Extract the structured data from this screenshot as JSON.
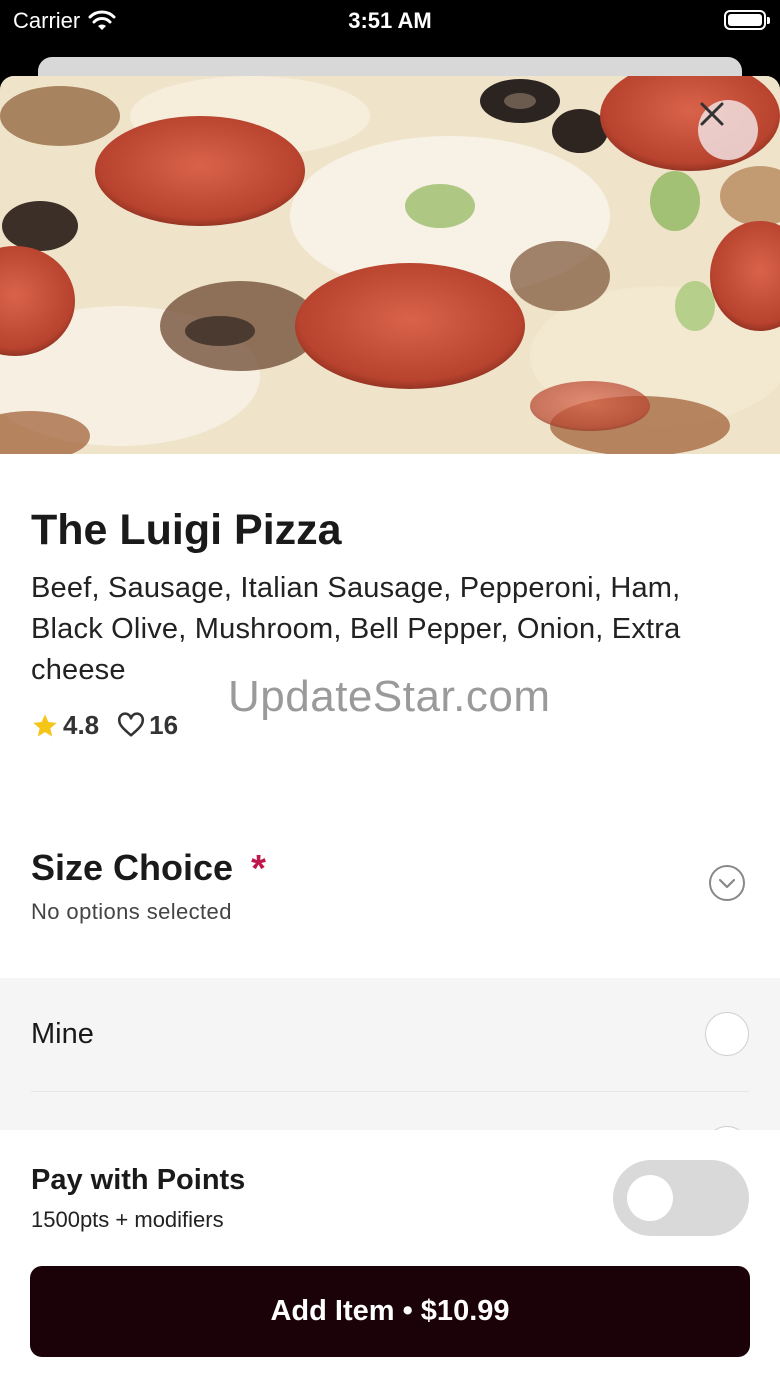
{
  "status_bar": {
    "carrier": "Carrier",
    "time": "3:51 AM"
  },
  "product": {
    "title": "The Luigi Pizza",
    "description": "Beef, Sausage, Italian Sausage, Pepperoni, Ham, Black Olive, Mushroom, Bell Pepper, Onion, Extra cheese",
    "rating": "4.8",
    "likes": "16"
  },
  "watermark": "UpdateStar.com",
  "size_choice": {
    "title": "Size Choice",
    "required_mark": "*",
    "subtitle": "No options selected",
    "options": [
      {
        "label": "Mine"
      }
    ]
  },
  "pay_with_points": {
    "title": "Pay with Points",
    "subtitle": "1500pts + modifiers",
    "enabled": false
  },
  "add_button": {
    "label": "Add Item • $10.99"
  },
  "colors": {
    "accent_required": "#c0174a",
    "button_bg": "#1a0208",
    "star": "#f5c518"
  },
  "icons": {
    "close": "close-icon",
    "star": "star-icon",
    "heart": "heart-icon",
    "chevron": "chevron-down-icon",
    "wifi": "wifi-icon",
    "battery": "battery-icon"
  }
}
